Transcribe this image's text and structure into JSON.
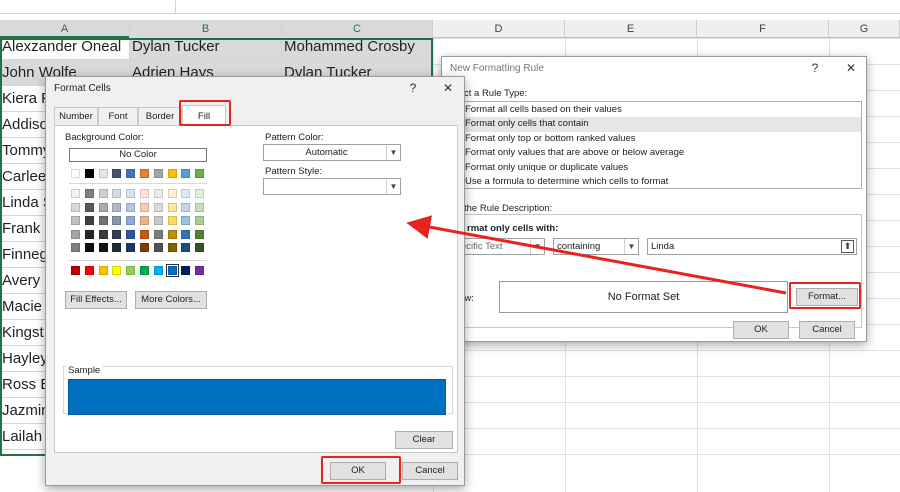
{
  "sheet": {
    "columns": [
      "A",
      "B",
      "C",
      "D",
      "E",
      "F",
      "G"
    ],
    "rows": [
      [
        "Alexzander Oneal",
        "Dylan Tucker",
        "Mohammed Crosby"
      ],
      [
        "John Wolfe",
        "Adrien Hays",
        "Dylan Tucker"
      ],
      [
        "Kiera F",
        "",
        ""
      ],
      [
        "Addiso",
        "",
        ""
      ],
      [
        "Tommy",
        "",
        ""
      ],
      [
        "Carlee",
        "",
        ""
      ],
      [
        "Linda S",
        "",
        ""
      ],
      [
        "Frank M",
        "",
        ""
      ],
      [
        "Finneg",
        "",
        ""
      ],
      [
        "Avery C",
        "",
        ""
      ],
      [
        "Macie",
        "",
        ""
      ],
      [
        "Kingst",
        "",
        ""
      ],
      [
        "Hayley",
        "",
        ""
      ],
      [
        "Ross B",
        "",
        ""
      ],
      [
        "Jazmin",
        "",
        ""
      ],
      [
        "Lailah I",
        "",
        ""
      ]
    ],
    "highlight_color": "#d9d9d9",
    "selection_color": "#217346"
  },
  "new_rule": {
    "title": "New Formatting Rule",
    "help": "?",
    "close": "✕",
    "select_type_label": "ct a Rule Type:",
    "rule_types": [
      "Format all cells based on their values",
      "Format only cells that contain",
      "Format only top or bottom ranked values",
      "Format only values that are above or below average",
      "Format only unique or duplicate values",
      "Use a formula to determine which cells to format"
    ],
    "selected_rule_index": 1,
    "edit_desc_label": "the Rule Description:",
    "format_only_label": "rmat only cells with:",
    "condition_type": "ecific Text",
    "operator": "containing",
    "value": "Linda",
    "preview_label": "iew:",
    "preview_text": "No Format Set",
    "format_button": "Format...",
    "ok_button": "OK",
    "cancel_button": "Cancel"
  },
  "format_cells": {
    "title": "Format Cells",
    "help": "?",
    "close": "✕",
    "tabs": [
      "Number",
      "Font",
      "Border",
      "Fill"
    ],
    "active_tab": "Fill",
    "background_color_label": "Background Color:",
    "no_color": "No Color",
    "pattern_color_label": "Pattern Color:",
    "pattern_color_value": "Automatic",
    "pattern_style_label": "Pattern Style:",
    "pattern_style_value": "",
    "fill_effects_button": "Fill Effects...",
    "more_colors_button": "More Colors...",
    "sample_label": "Sample",
    "sample_color": "#0070c0",
    "clear_button": "Clear",
    "ok_button": "OK",
    "cancel_button": "Cancel",
    "palette_row1": [
      "#ffffff",
      "#000000",
      "#e7e6e6",
      "#44546a",
      "#4472c4",
      "#ed7d31",
      "#a5a5a5",
      "#ffc000",
      "#5b9bd5",
      "#70ad47"
    ],
    "palette_tints": [
      [
        "#f2f2f2",
        "#7f7f7f",
        "#d0cece",
        "#d6dce4",
        "#d9e1f2",
        "#fce4d6",
        "#ededed",
        "#fff2cc",
        "#ddebf7",
        "#e2efda"
      ],
      [
        "#d9d9d9",
        "#595959",
        "#aeaaaa",
        "#acb9ca",
        "#b4c6e7",
        "#f8cbad",
        "#dbdbdb",
        "#ffe699",
        "#bdd7ee",
        "#c6e0b4"
      ],
      [
        "#bfbfbf",
        "#404040",
        "#757171",
        "#8497b0",
        "#8ea9db",
        "#f4b084",
        "#c9c9c9",
        "#ffd966",
        "#9bc2e6",
        "#a9d08e"
      ],
      [
        "#a6a6a6",
        "#262626",
        "#3a3838",
        "#333f4f",
        "#2f5597",
        "#c65911",
        "#7b7b7b",
        "#bf8f00",
        "#2e75b6",
        "#548235"
      ],
      [
        "#808080",
        "#0d0d0d",
        "#161616",
        "#222b35",
        "#203764",
        "#833c0c",
        "#525252",
        "#806000",
        "#1f4e78",
        "#375623"
      ]
    ],
    "palette_standard": [
      "#c00000",
      "#ff0000",
      "#ffc000",
      "#ffff00",
      "#92d050",
      "#00b050",
      "#00b0f0",
      "#0070c0",
      "#002060",
      "#7030a0"
    ],
    "selected_standard_index": 7
  },
  "annotations": {
    "color": "#e8231f"
  }
}
